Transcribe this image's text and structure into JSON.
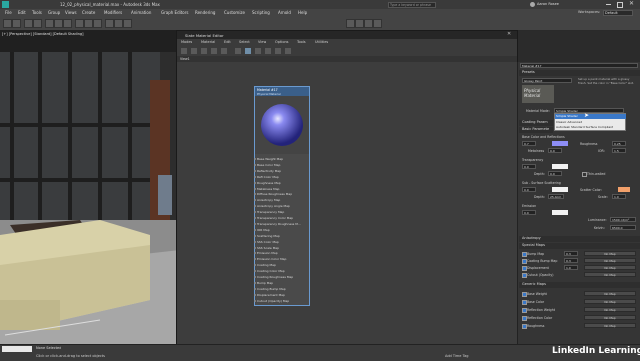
{
  "window": {
    "file_title": "12_02_physical_material.max - Autodesk 3ds Max",
    "search_placeholder": "Type a keyword or phrase",
    "user": "Aaron Rosee",
    "workspace_label": "Workspaces:",
    "workspace_value": "Default"
  },
  "menus": [
    "File",
    "Edit",
    "Tools",
    "Group",
    "Views",
    "Create",
    "Modifiers",
    "Animation",
    "Graph Editors",
    "Rendering",
    "Customize",
    "Scripting",
    "Arnold",
    "Help"
  ],
  "viewport": {
    "label": "[+] [Perspective] [Standard] [Default Shading]"
  },
  "sme": {
    "title": "Slate Material Editor",
    "menus": [
      "Modes",
      "Material",
      "Edit",
      "Select",
      "View",
      "Options",
      "Tools",
      "Utilities"
    ],
    "tab": "View1",
    "status": "Rendering finished"
  },
  "node": {
    "title": "Material #17",
    "subtitle": "Physical Material",
    "maps": [
      "Base Weight Map",
      "Base Color Map",
      "Reflectivity Map",
      "Refl Color Map",
      "Roughness Map",
      "Metalness Map",
      "Diffuse Roughness Map",
      "Anisotropy Map",
      "Anisotropy Angle Map",
      "Transparency Map",
      "Transparency Color Map",
      "Transparency Roughness M...",
      "IOR Map",
      "Scattering Map",
      "SSS Color Map",
      "SSS Scale Map",
      "Emission Map",
      "Emission Color Map",
      "Coating Map",
      "Coating Color Map",
      "Coating Roughness Map",
      "Bump Map",
      "Coating Bump Map",
      "Displacement Map",
      "Cutout (Opacity) Map"
    ]
  },
  "panel": {
    "material_name": "Material #17",
    "presets_label": "Presets",
    "preset_value": "Glossy Paint",
    "preset_hint": "Set up a paint material with a glossy finish. Set the color in \"Base Color\" slot.",
    "thumb_text": "Physical Material",
    "material_mode_label": "Material Mode:",
    "material_mode_value": "Simple Shader",
    "mode_options": [
      "Simple Shader",
      "Classic Advanced",
      "Autodesk Standard Surface Compliant"
    ],
    "coating_label": "Coating Param",
    "basic_label": "Basic Paramete",
    "base_color_label": "Base Color and Reflections",
    "base_weight": "0.7",
    "roughness_label": "Roughness",
    "roughness_value": "0.25",
    "metalness_label": "Metalness",
    "metalness_value": "0.0",
    "ior_label": "IOR:",
    "ior_value": "1.5",
    "transparency_label": "Transparency",
    "transparency_value": "0.0",
    "depth_label": "Depth:",
    "depth_value": "0.0",
    "thin_walled": "Thin-walled",
    "sss_label": "Sub - Surface Scattering",
    "sss_value": "0.0",
    "scatter_color_label": "Scatter Color:",
    "sss_depth": "25.4cm",
    "scale_label": "Scale:",
    "scale_value": "1.0",
    "emission_label": "Emission",
    "emission_value": "0.0",
    "luminance_label": "Luminance:",
    "luminance_value": "1500 cd/m²",
    "kelvin_label": "Kelvin:",
    "kelvin_value": "6500.0",
    "anisotropy_label": "Anisotropy",
    "special_maps_label": "Special Maps",
    "bump_map": "Bump Map",
    "coating_bump_map": "Coating Bump Map",
    "displacement": "Displacement",
    "cutout": "Cutout (Opacity)",
    "special_values": [
      "0.3",
      "0.3",
      "1.0"
    ],
    "no_map": "No Map",
    "generic_maps_label": "Generic Maps",
    "generic_maps": [
      "Base Weight",
      "Base Color",
      "Reflection Weight",
      "Reflection Color",
      "Roughness"
    ],
    "base_color_hex": "#8d8df5",
    "scatter_color_hex": "#f2a06a"
  },
  "bottom": {
    "selected": "None Selected",
    "hint": "Click or click-and-drag to select objects",
    "add_time_tag": "Add Time Tag",
    "brand": "LinkedIn Learning"
  }
}
